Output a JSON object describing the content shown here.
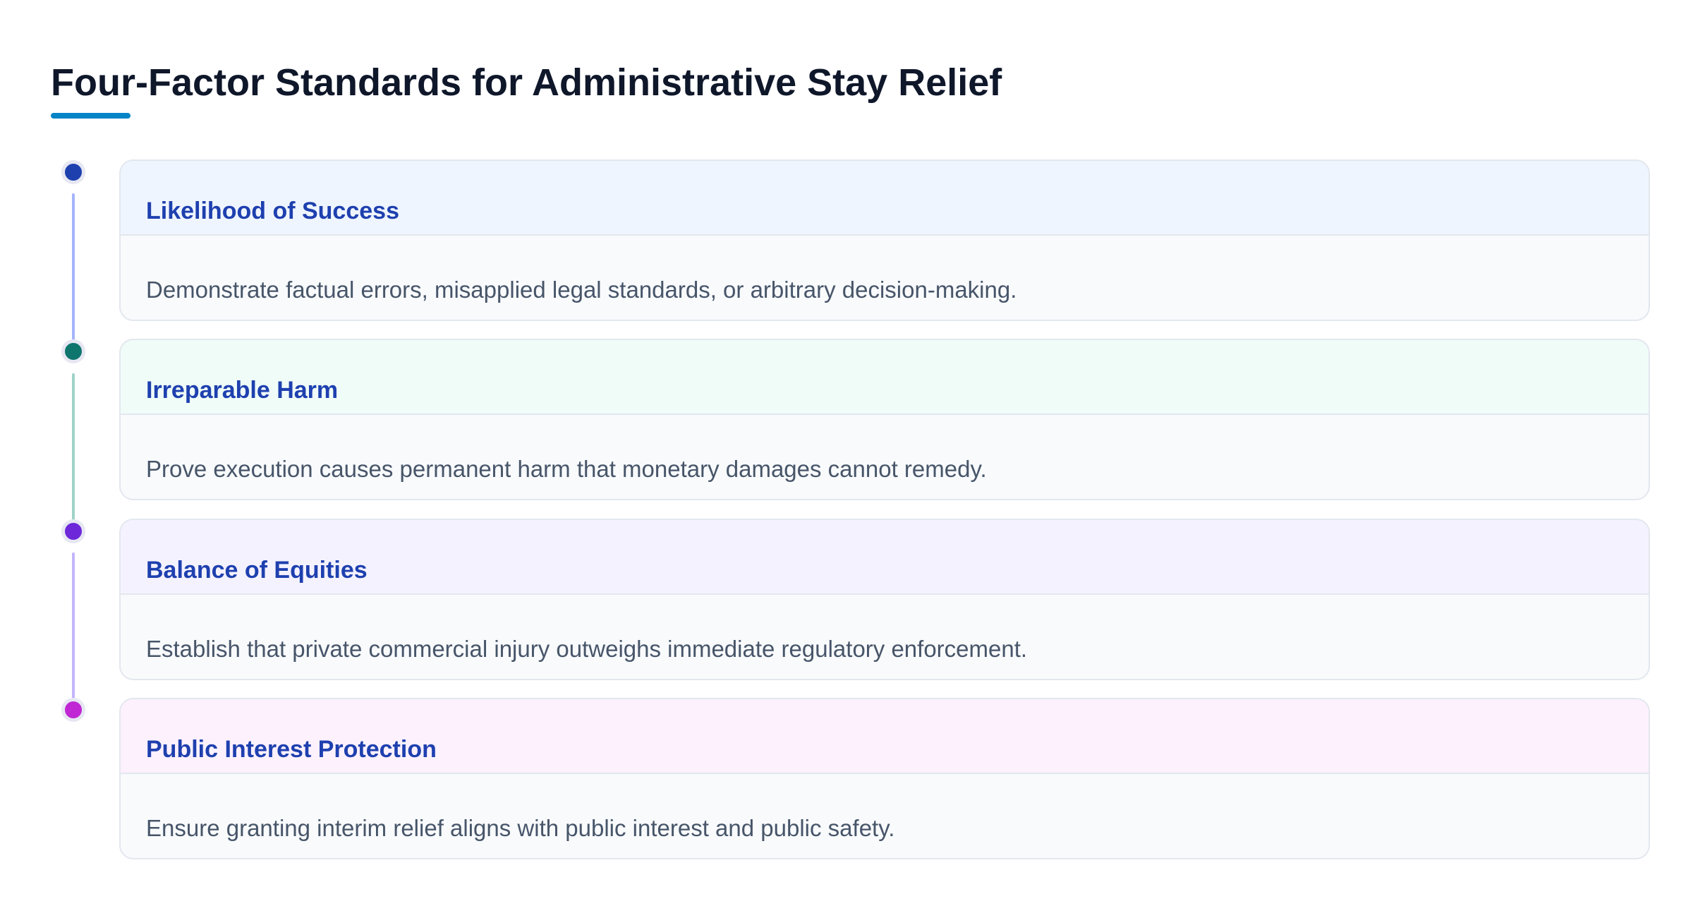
{
  "page": {
    "title": "Four-Factor Standards for Administrative Stay Relief",
    "accent_color": "#0284c7"
  },
  "factors": [
    {
      "title": "Likelihood of Success",
      "description": "Demonstrate factual errors, misapplied legal standards, or arbitrary decision-making.",
      "dot_color": "#1e40af",
      "header_bg": "#eff5ff",
      "line_color": "#a5b4fc"
    },
    {
      "title": "Irreparable Harm",
      "description": "Prove execution causes permanent harm that monetary damages cannot remedy.",
      "dot_color": "#0f766e",
      "header_bg": "#effcf8",
      "line_color": "#9fd3c8"
    },
    {
      "title": "Balance of Equities",
      "description": "Establish that private commercial injury outweighs immediate regulatory enforcement.",
      "dot_color": "#6d28d9",
      "header_bg": "#f4f2fe",
      "line_color": "#c4b5fd"
    },
    {
      "title": "Public Interest Protection",
      "description": "Ensure granting interim relief aligns with public interest and public safety.",
      "dot_color": "#c026d3",
      "header_bg": "#fdf1fd",
      "line_color": "#f0abfc"
    }
  ]
}
